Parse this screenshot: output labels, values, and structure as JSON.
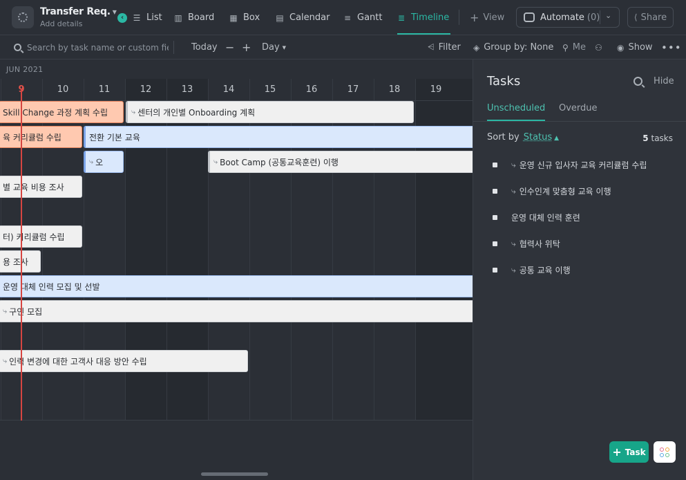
{
  "header": {
    "title": "Transfer Req.",
    "subtitle": "Add details",
    "views": [
      {
        "label": "List",
        "icon": "list-icon"
      },
      {
        "label": "Board",
        "icon": "board-icon"
      },
      {
        "label": "Box",
        "icon": "box-icon"
      },
      {
        "label": "Calendar",
        "icon": "calendar-icon"
      },
      {
        "label": "Gantt",
        "icon": "gantt-icon"
      },
      {
        "label": "Timeline",
        "icon": "timeline-icon",
        "active": true
      }
    ],
    "add_view": "View",
    "automate_label": "Automate",
    "automate_count": "(0)",
    "share_label": "Share"
  },
  "toolbar": {
    "search_placeholder": "Search by task name or custom field...",
    "today": "Today",
    "minus": "−",
    "plus": "+",
    "scale": "Day",
    "filter": "Filter",
    "group_by": "Group by: None",
    "me": "Me",
    "show": "Show"
  },
  "timeline": {
    "month": "JUN 2021",
    "today_day": "9",
    "days": [
      "9",
      "10",
      "11",
      "12",
      "13",
      "14",
      "15",
      "16",
      "17",
      "18",
      "19"
    ],
    "weekend_days": [
      "12",
      "13",
      "19"
    ],
    "bars": [
      {
        "label": "Skill Change 과정 계획 수립",
        "color": "orange",
        "subtask": false
      },
      {
        "label": "센터의 개인별 Onboarding 계획",
        "color": "gray",
        "subtask": true
      },
      {
        "label": "육 커리큘럼 수립",
        "color": "orange",
        "subtask": false
      },
      {
        "label": "전환 기본 교육",
        "color": "blue",
        "subtask": false
      },
      {
        "label": "오",
        "color": "blue",
        "subtask": true
      },
      {
        "label": "Boot Camp (공통교육훈련) 이행",
        "color": "gray",
        "subtask": true
      },
      {
        "label": "별 교육 비용 조사",
        "color": "gray",
        "subtask": false
      },
      {
        "label": "터) 커리큘럼 수립",
        "color": "gray",
        "subtask": false
      },
      {
        "label": "용 조사",
        "color": "gray",
        "subtask": false
      },
      {
        "label": "운영 대체 인력 모집 및 선발",
        "color": "blue",
        "subtask": false
      },
      {
        "label": "구인 모집",
        "color": "gray",
        "subtask": true
      },
      {
        "label": "인력 변경에 대한 고객사 대응 방안 수립",
        "color": "gray",
        "subtask": true
      }
    ]
  },
  "tasks_panel": {
    "title": "Tasks",
    "hide": "Hide",
    "tabs": [
      "Unscheduled",
      "Overdue"
    ],
    "active_tab": "Unscheduled",
    "sort_label": "Sort by",
    "sort_value": "Status",
    "count_number": "5",
    "count_suffix": "tasks",
    "items": [
      {
        "label": "운영 신규 입사자 교육 커리큘럼 수립",
        "subtask": true
      },
      {
        "label": "인수인계 맞춤형 교육 이행",
        "subtask": true
      },
      {
        "label": "운영 대체 인력 훈련",
        "subtask": false
      },
      {
        "label": "협력사 위탁",
        "subtask": true
      },
      {
        "label": "공통 교육 이행",
        "subtask": true
      }
    ],
    "add_task": "Task"
  },
  "colors": {
    "accent": "#2bb8a4",
    "today_line": "#d64541",
    "bar_orange": "#ffc9b0",
    "bar_blue": "#dae8fc",
    "bar_gray": "#f0f0f0"
  }
}
